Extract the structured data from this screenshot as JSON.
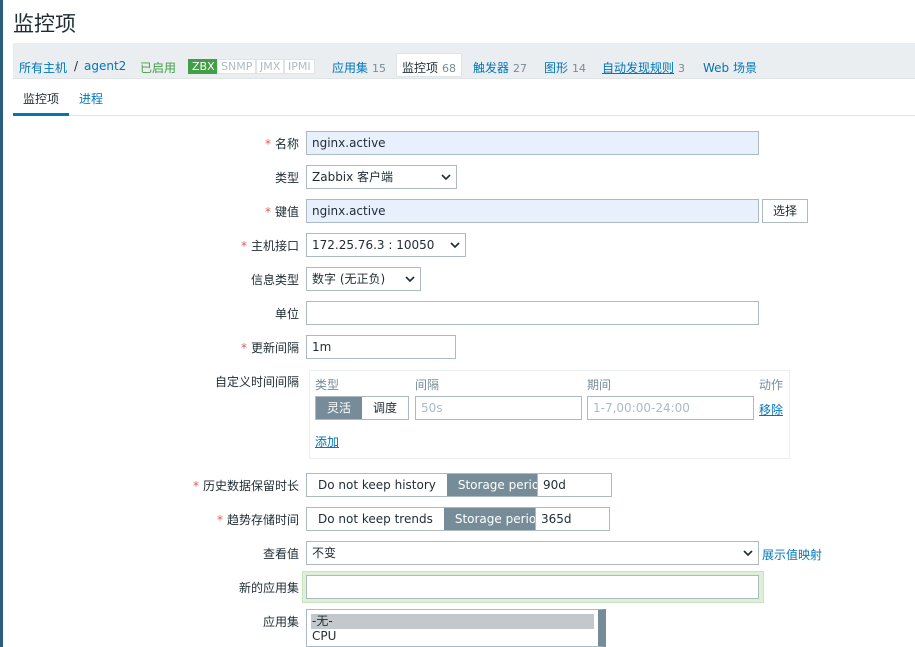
{
  "page": {
    "title": "监控项"
  },
  "breadcrumb": {
    "all_hosts": "所有主机",
    "separator": "/",
    "host": "agent2",
    "status": "已启用",
    "badges": [
      "ZBX",
      "SNMP",
      "JMX",
      "IPMI"
    ]
  },
  "host_nav": {
    "applications": {
      "label": "应用集",
      "count": "15"
    },
    "items": {
      "label": "监控项",
      "count": "68"
    },
    "triggers": {
      "label": "触发器",
      "count": "27"
    },
    "graphs": {
      "label": "图形",
      "count": "14"
    },
    "discovery": {
      "label": "自动发现规则",
      "count": "3"
    },
    "web": {
      "label": "Web 场景"
    }
  },
  "tabs": [
    "监控项",
    "进程"
  ],
  "form": {
    "name": {
      "label": "名称",
      "value": "nginx.active"
    },
    "type": {
      "label": "类型",
      "value": "Zabbix 客户端"
    },
    "key": {
      "label": "键值",
      "value": "nginx.active",
      "button": "选择"
    },
    "interface": {
      "label": "主机接口",
      "value": "172.25.76.3 : 10050"
    },
    "value_type": {
      "label": "信息类型",
      "value": "数字 (无正负)"
    },
    "units": {
      "label": "单位",
      "value": ""
    },
    "delay": {
      "label": "更新间隔",
      "value": "1m"
    },
    "custom_intervals": {
      "label": "自定义时间间隔",
      "headers": [
        "类型",
        "间隔",
        "期间",
        "动作"
      ],
      "mode_flexible": "灵活",
      "mode_scheduling": "调度",
      "interval_placeholder": "50s",
      "period_placeholder": "1-7,00:00-24:00",
      "remove": "移除",
      "add": "添加"
    },
    "history": {
      "label": "历史数据保留时长",
      "opt_no": "Do not keep history",
      "opt_period": "Storage period",
      "value": "90d"
    },
    "trends": {
      "label": "趋势存储时间",
      "opt_no": "Do not keep trends",
      "opt_period": "Storage period",
      "value": "365d"
    },
    "valuemap": {
      "label": "查看值",
      "value": "不变",
      "link": "展示值映射"
    },
    "new_application": {
      "label": "新的应用集",
      "value": ""
    },
    "applications": {
      "label": "应用集",
      "options": [
        "-无-",
        "CPU"
      ]
    }
  }
}
